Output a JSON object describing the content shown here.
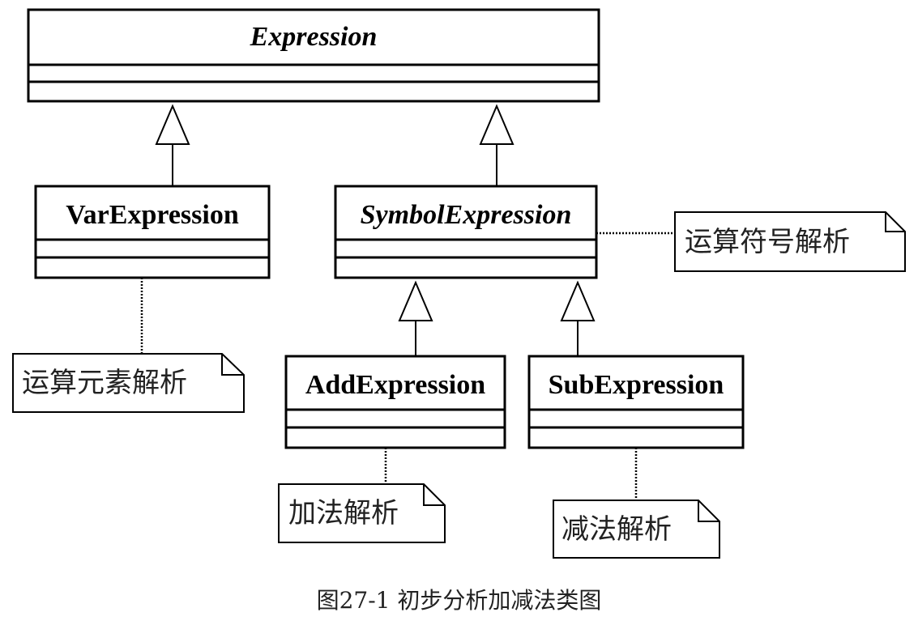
{
  "classes": {
    "expression": "Expression",
    "var_expression": "VarExpression",
    "symbol_expression": "SymbolExpression",
    "add_expression": "AddExpression",
    "sub_expression": "SubExpression"
  },
  "notes": {
    "symbol": "运算符号解析",
    "var": "运算元素解析",
    "add": "加法解析",
    "sub": "减法解析"
  },
  "caption": "图27-1 初步分析加减法类图"
}
